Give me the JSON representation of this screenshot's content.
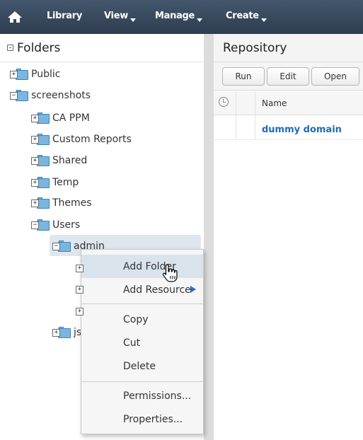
{
  "nav": {
    "items": [
      {
        "label": "Library",
        "dropdown": false
      },
      {
        "label": "View",
        "dropdown": true
      },
      {
        "label": "Manage",
        "dropdown": true
      },
      {
        "label": "Create",
        "dropdown": true
      }
    ]
  },
  "folders_panel": {
    "title": "Folders",
    "tree": [
      {
        "label": "Public",
        "expander": "+"
      },
      {
        "label": "screenshots",
        "expander": "−"
      },
      {
        "label": "CA PPM",
        "expander": "+"
      },
      {
        "label": "Custom Reports",
        "expander": "+"
      },
      {
        "label": "Shared",
        "expander": "+"
      },
      {
        "label": "Temp",
        "expander": "+"
      },
      {
        "label": "Themes",
        "expander": "+"
      },
      {
        "label": "Users",
        "expander": "−"
      },
      {
        "label": "admin",
        "expander": "−"
      },
      {
        "label": "",
        "expander": "+"
      },
      {
        "label": "",
        "expander": "+"
      },
      {
        "label": "",
        "expander": "+"
      },
      {
        "label": "jsutl",
        "expander": "+"
      }
    ]
  },
  "repository": {
    "title": "Repository",
    "toolbar": {
      "run": "Run",
      "edit": "Edit",
      "open": "Open"
    },
    "columns": {
      "name": "Name"
    },
    "rows": [
      {
        "name": "dummy domain"
      }
    ]
  },
  "context_menu": {
    "items": {
      "add_folder": "Add Folder",
      "add_resource": "Add Resource",
      "copy": "Copy",
      "cut": "Cut",
      "delete": "Delete",
      "permissions": "Permissions...",
      "properties": "Properties..."
    }
  },
  "colors": {
    "topbar": "#3a4b5f",
    "link": "#1e6bb8",
    "selection": "#dfe6ee",
    "menu_hover": "#d9e3ec"
  }
}
